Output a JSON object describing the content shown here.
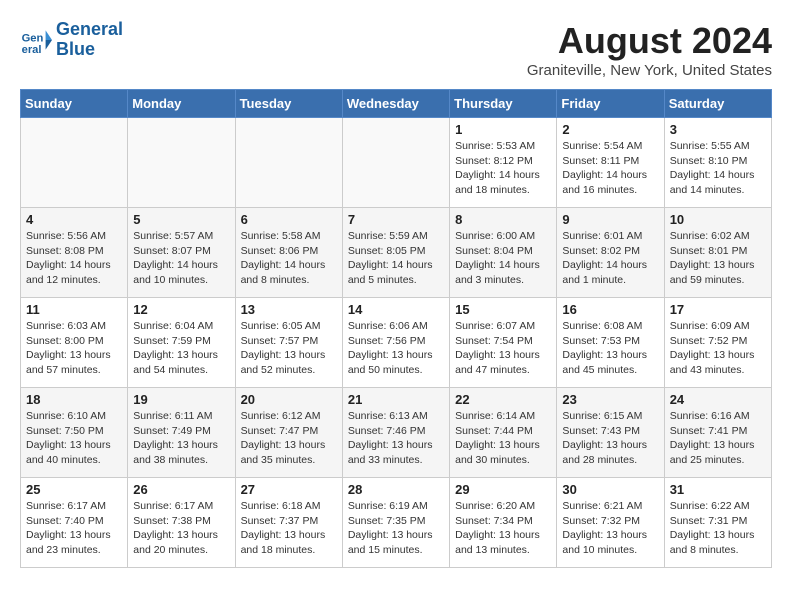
{
  "logo": {
    "line1": "General",
    "line2": "Blue"
  },
  "title": "August 2024",
  "subtitle": "Graniteville, New York, United States",
  "weekdays": [
    "Sunday",
    "Monday",
    "Tuesday",
    "Wednesday",
    "Thursday",
    "Friday",
    "Saturday"
  ],
  "weeks": [
    [
      {
        "day": "",
        "info": ""
      },
      {
        "day": "",
        "info": ""
      },
      {
        "day": "",
        "info": ""
      },
      {
        "day": "",
        "info": ""
      },
      {
        "day": "1",
        "info": "Sunrise: 5:53 AM\nSunset: 8:12 PM\nDaylight: 14 hours\nand 18 minutes."
      },
      {
        "day": "2",
        "info": "Sunrise: 5:54 AM\nSunset: 8:11 PM\nDaylight: 14 hours\nand 16 minutes."
      },
      {
        "day": "3",
        "info": "Sunrise: 5:55 AM\nSunset: 8:10 PM\nDaylight: 14 hours\nand 14 minutes."
      }
    ],
    [
      {
        "day": "4",
        "info": "Sunrise: 5:56 AM\nSunset: 8:08 PM\nDaylight: 14 hours\nand 12 minutes."
      },
      {
        "day": "5",
        "info": "Sunrise: 5:57 AM\nSunset: 8:07 PM\nDaylight: 14 hours\nand 10 minutes."
      },
      {
        "day": "6",
        "info": "Sunrise: 5:58 AM\nSunset: 8:06 PM\nDaylight: 14 hours\nand 8 minutes."
      },
      {
        "day": "7",
        "info": "Sunrise: 5:59 AM\nSunset: 8:05 PM\nDaylight: 14 hours\nand 5 minutes."
      },
      {
        "day": "8",
        "info": "Sunrise: 6:00 AM\nSunset: 8:04 PM\nDaylight: 14 hours\nand 3 minutes."
      },
      {
        "day": "9",
        "info": "Sunrise: 6:01 AM\nSunset: 8:02 PM\nDaylight: 14 hours\nand 1 minute."
      },
      {
        "day": "10",
        "info": "Sunrise: 6:02 AM\nSunset: 8:01 PM\nDaylight: 13 hours\nand 59 minutes."
      }
    ],
    [
      {
        "day": "11",
        "info": "Sunrise: 6:03 AM\nSunset: 8:00 PM\nDaylight: 13 hours\nand 57 minutes."
      },
      {
        "day": "12",
        "info": "Sunrise: 6:04 AM\nSunset: 7:59 PM\nDaylight: 13 hours\nand 54 minutes."
      },
      {
        "day": "13",
        "info": "Sunrise: 6:05 AM\nSunset: 7:57 PM\nDaylight: 13 hours\nand 52 minutes."
      },
      {
        "day": "14",
        "info": "Sunrise: 6:06 AM\nSunset: 7:56 PM\nDaylight: 13 hours\nand 50 minutes."
      },
      {
        "day": "15",
        "info": "Sunrise: 6:07 AM\nSunset: 7:54 PM\nDaylight: 13 hours\nand 47 minutes."
      },
      {
        "day": "16",
        "info": "Sunrise: 6:08 AM\nSunset: 7:53 PM\nDaylight: 13 hours\nand 45 minutes."
      },
      {
        "day": "17",
        "info": "Sunrise: 6:09 AM\nSunset: 7:52 PM\nDaylight: 13 hours\nand 43 minutes."
      }
    ],
    [
      {
        "day": "18",
        "info": "Sunrise: 6:10 AM\nSunset: 7:50 PM\nDaylight: 13 hours\nand 40 minutes."
      },
      {
        "day": "19",
        "info": "Sunrise: 6:11 AM\nSunset: 7:49 PM\nDaylight: 13 hours\nand 38 minutes."
      },
      {
        "day": "20",
        "info": "Sunrise: 6:12 AM\nSunset: 7:47 PM\nDaylight: 13 hours\nand 35 minutes."
      },
      {
        "day": "21",
        "info": "Sunrise: 6:13 AM\nSunset: 7:46 PM\nDaylight: 13 hours\nand 33 minutes."
      },
      {
        "day": "22",
        "info": "Sunrise: 6:14 AM\nSunset: 7:44 PM\nDaylight: 13 hours\nand 30 minutes."
      },
      {
        "day": "23",
        "info": "Sunrise: 6:15 AM\nSunset: 7:43 PM\nDaylight: 13 hours\nand 28 minutes."
      },
      {
        "day": "24",
        "info": "Sunrise: 6:16 AM\nSunset: 7:41 PM\nDaylight: 13 hours\nand 25 minutes."
      }
    ],
    [
      {
        "day": "25",
        "info": "Sunrise: 6:17 AM\nSunset: 7:40 PM\nDaylight: 13 hours\nand 23 minutes."
      },
      {
        "day": "26",
        "info": "Sunrise: 6:17 AM\nSunset: 7:38 PM\nDaylight: 13 hours\nand 20 minutes."
      },
      {
        "day": "27",
        "info": "Sunrise: 6:18 AM\nSunset: 7:37 PM\nDaylight: 13 hours\nand 18 minutes."
      },
      {
        "day": "28",
        "info": "Sunrise: 6:19 AM\nSunset: 7:35 PM\nDaylight: 13 hours\nand 15 minutes."
      },
      {
        "day": "29",
        "info": "Sunrise: 6:20 AM\nSunset: 7:34 PM\nDaylight: 13 hours\nand 13 minutes."
      },
      {
        "day": "30",
        "info": "Sunrise: 6:21 AM\nSunset: 7:32 PM\nDaylight: 13 hours\nand 10 minutes."
      },
      {
        "day": "31",
        "info": "Sunrise: 6:22 AM\nSunset: 7:31 PM\nDaylight: 13 hours\nand 8 minutes."
      }
    ]
  ]
}
